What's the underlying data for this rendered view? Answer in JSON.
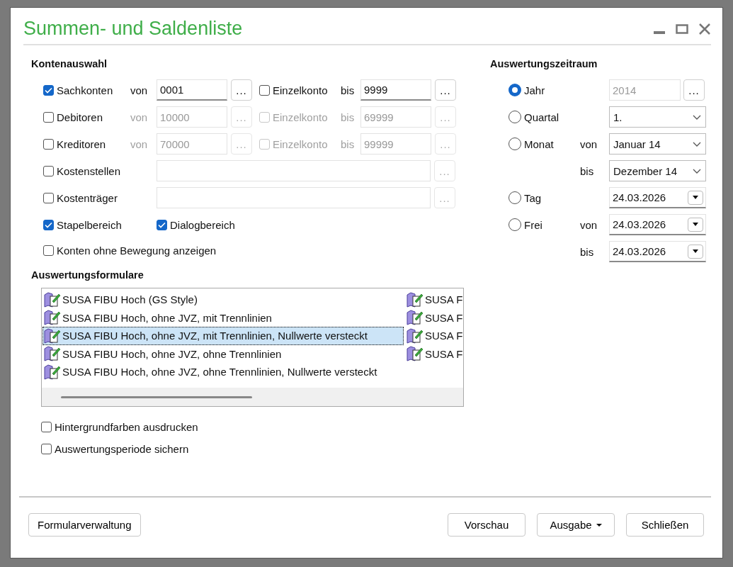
{
  "window": {
    "title": "Summen- und Saldenliste"
  },
  "accounts": {
    "heading": "Kontenauswahl",
    "rows": [
      {
        "kind": "range",
        "label": "Sachkonten",
        "checked": true,
        "disabled": false,
        "from_label": "von",
        "from": "0001",
        "from_browse": "...",
        "single_label": "Einzelkonto",
        "single_checked": false,
        "to_label": "bis",
        "to": "9999",
        "to_browse": "..."
      },
      {
        "kind": "range",
        "label": "Debitoren",
        "checked": false,
        "disabled": true,
        "from_label": "von",
        "from": "10000",
        "from_browse": "...",
        "single_label": "Einzelkonto",
        "single_checked": false,
        "to_label": "bis",
        "to": "69999",
        "to_browse": "..."
      },
      {
        "kind": "range",
        "label": "Kreditoren",
        "checked": false,
        "disabled": true,
        "from_label": "von",
        "from": "70000",
        "from_browse": "...",
        "single_label": "Einzelkonto",
        "single_checked": false,
        "to_label": "bis",
        "to": "99999",
        "to_browse": "..."
      },
      {
        "kind": "field",
        "label": "Kostenstellen",
        "checked": false,
        "disabled": true,
        "browse": "..."
      },
      {
        "kind": "field",
        "label": "Kostenträger",
        "checked": false,
        "disabled": true,
        "browse": "..."
      }
    ],
    "areas": [
      {
        "label": "Stapelbereich",
        "checked": true
      },
      {
        "label": "Dialogbereich",
        "checked": true
      }
    ],
    "show_inactive": {
      "label": "Konten ohne Bewegung anzeigen",
      "checked": false
    }
  },
  "forms": {
    "heading": "Auswertungsformulare",
    "columns": [
      [
        {
          "label": "SUSA FIBU Hoch (GS Style)",
          "selected": false
        },
        {
          "label": "SUSA FIBU Hoch, ohne JVZ, mit Trennlinien",
          "selected": false
        },
        {
          "label": "SUSA FIBU Hoch, ohne JVZ, mit Trennlinien, Nullwerte versteckt",
          "selected": true
        },
        {
          "label": "SUSA FIBU Hoch, ohne JVZ, ohne Trennlinien",
          "selected": false
        },
        {
          "label": "SUSA FIBU Hoch, ohne JVZ, ohne Trennlinien, Nullwerte versteckt",
          "selected": false
        }
      ],
      [
        {
          "label": "SUSA F",
          "selected": false
        },
        {
          "label": "SUSA F",
          "selected": false
        },
        {
          "label": "SUSA F",
          "selected": false
        },
        {
          "label": "SUSA F",
          "selected": false
        }
      ]
    ]
  },
  "print_options": [
    {
      "label": "Hintergrundfarben ausdrucken",
      "checked": false
    },
    {
      "label": "Auswertungsperiode sichern",
      "checked": false
    }
  ],
  "period": {
    "heading": "Auswertungszeitraum",
    "options": [
      {
        "label": "Jahr",
        "selected": true,
        "rows": [
          {
            "kind": "text",
            "value": "2014",
            "disabled": true,
            "browse": "..."
          }
        ]
      },
      {
        "label": "Quartal",
        "selected": false,
        "rows": [
          {
            "kind": "select",
            "value": "1."
          }
        ]
      },
      {
        "label": "Monat",
        "selected": false,
        "rows": [
          {
            "prefix": "von",
            "kind": "select",
            "value": "Januar 14"
          },
          {
            "prefix": "bis",
            "kind": "select",
            "value": "Dezember 14"
          }
        ]
      },
      {
        "label": "Tag",
        "selected": false,
        "rows": [
          {
            "kind": "date",
            "value": "24.03.2026"
          }
        ]
      },
      {
        "label": "Frei",
        "selected": false,
        "rows": [
          {
            "prefix": "von",
            "kind": "date",
            "value": "24.03.2026"
          },
          {
            "prefix": "bis",
            "kind": "date",
            "value": "24.03.2026"
          }
        ]
      }
    ]
  },
  "footer": {
    "left": [
      {
        "label": "Formularverwaltung",
        "kind": "plain"
      }
    ],
    "right": [
      {
        "label": "Vorschau",
        "kind": "plain"
      },
      {
        "label": "Ausgabe",
        "kind": "menu"
      },
      {
        "label": "Schließen",
        "kind": "plain"
      }
    ]
  }
}
